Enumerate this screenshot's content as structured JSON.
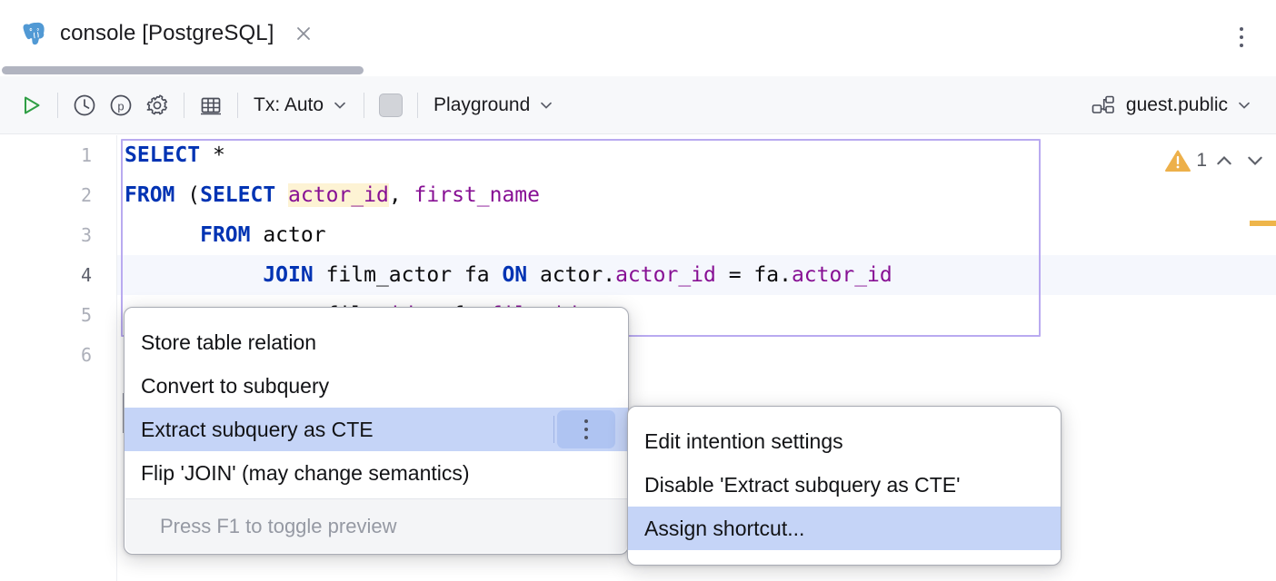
{
  "window": {
    "tab": {
      "title": "console [PostgreSQL]",
      "db_icon": "postgresql-elephant-icon",
      "close_icon": "close-icon"
    },
    "options_menu_icon": "kebab-vertical-icon"
  },
  "toolbar": {
    "run_icon": "run-play-icon",
    "history_icon": "clock-history-icon",
    "parameters_icon": "circled-p-parameters-icon",
    "settings_icon": "gear-settings-icon",
    "table_icon": "grid-table-icon",
    "tx_label": "Tx: Auto",
    "tx_chevron_icon": "chevron-down-icon",
    "stop_icon": "stop-square-icon",
    "schema_label": "Playground",
    "schema_chevron_icon": "chevron-down-icon",
    "session_icon": "database-schema-icon",
    "session_label": "guest.public",
    "session_chevron_icon": "chevron-down-icon"
  },
  "editor": {
    "line_numbers": [
      "1",
      "2",
      "3",
      "4",
      "5",
      "6"
    ],
    "current_line": 4,
    "lines": [
      {
        "n": 1,
        "tokens": [
          {
            "t": "SELECT",
            "c": "kw"
          },
          {
            "t": " *",
            "c": ""
          }
        ]
      },
      {
        "n": 2,
        "tokens": [
          {
            "t": "FROM",
            "c": "kw"
          },
          {
            "t": " (",
            "c": ""
          },
          {
            "t": "SELECT",
            "c": "kw"
          },
          {
            "t": " ",
            "c": ""
          },
          {
            "t": "actor_id",
            "c": "col hl"
          },
          {
            "t": ", ",
            "c": ""
          },
          {
            "t": "first_name",
            "c": "col"
          }
        ]
      },
      {
        "n": 3,
        "tokens": [
          {
            "t": "      ",
            "c": ""
          },
          {
            "t": "FROM",
            "c": "kw"
          },
          {
            "t": " actor",
            "c": ""
          }
        ]
      },
      {
        "n": 4,
        "tokens": [
          {
            "t": "           ",
            "c": ""
          },
          {
            "t": "JOIN",
            "c": "kw"
          },
          {
            "t": " film_actor fa ",
            "c": ""
          },
          {
            "t": "ON",
            "c": "kw"
          },
          {
            "t": " actor.",
            "c": ""
          },
          {
            "t": "actor_id",
            "c": "col"
          },
          {
            "t": " = fa.",
            "c": ""
          },
          {
            "t": "actor_id",
            "c": "col"
          }
        ]
      },
      {
        "n": 5,
        "tokens": [
          {
            "t": "           ",
            "c": ""
          },
          {
            "t": "     film",
            "c": ""
          },
          {
            "t": "_id",
            "c": "col"
          },
          {
            "t": " = fa.",
            "c": ""
          },
          {
            "t": "film_id",
            "c": "col"
          }
        ]
      },
      {
        "n": 6,
        "tokens": [
          {
            "t": "",
            "c": ""
          }
        ]
      }
    ],
    "intention_bulb_icon": "lightbulb-intention-icon",
    "intention_bulb_chevron_icon": "chevron-down-icon",
    "inspection": {
      "warning_icon": "warning-triangle-icon",
      "warning_count": "1",
      "prev_icon": "chevron-up-icon",
      "next_icon": "chevron-down-icon",
      "marker_color": "#eeb54a"
    }
  },
  "intention_popup": {
    "items": [
      {
        "label": "Store table relation",
        "selected": false,
        "has_submenu_button": false
      },
      {
        "label": "Convert to subquery",
        "selected": false,
        "has_submenu_button": false
      },
      {
        "label": "Extract subquery as CTE",
        "selected": true,
        "has_submenu_button": true
      },
      {
        "label": "Flip 'JOIN' (may change semantics)",
        "selected": false,
        "has_submenu_button": false
      }
    ],
    "submenu_button_icon": "kebab-vertical-icon",
    "footer": "Press F1 to toggle preview"
  },
  "submenu_popup": {
    "items": [
      {
        "label": "Edit intention settings",
        "selected": false
      },
      {
        "label": "Disable 'Extract subquery as CTE'",
        "selected": false
      },
      {
        "label": "Assign shortcut...",
        "selected": true
      }
    ]
  },
  "colors": {
    "keyword": "#0033b3",
    "column": "#871094",
    "selection": "#c5d4f7",
    "statement_border": "#b9aaf0",
    "current_line": "#f5f7fd",
    "search_highlight": "#fdf3d4"
  }
}
